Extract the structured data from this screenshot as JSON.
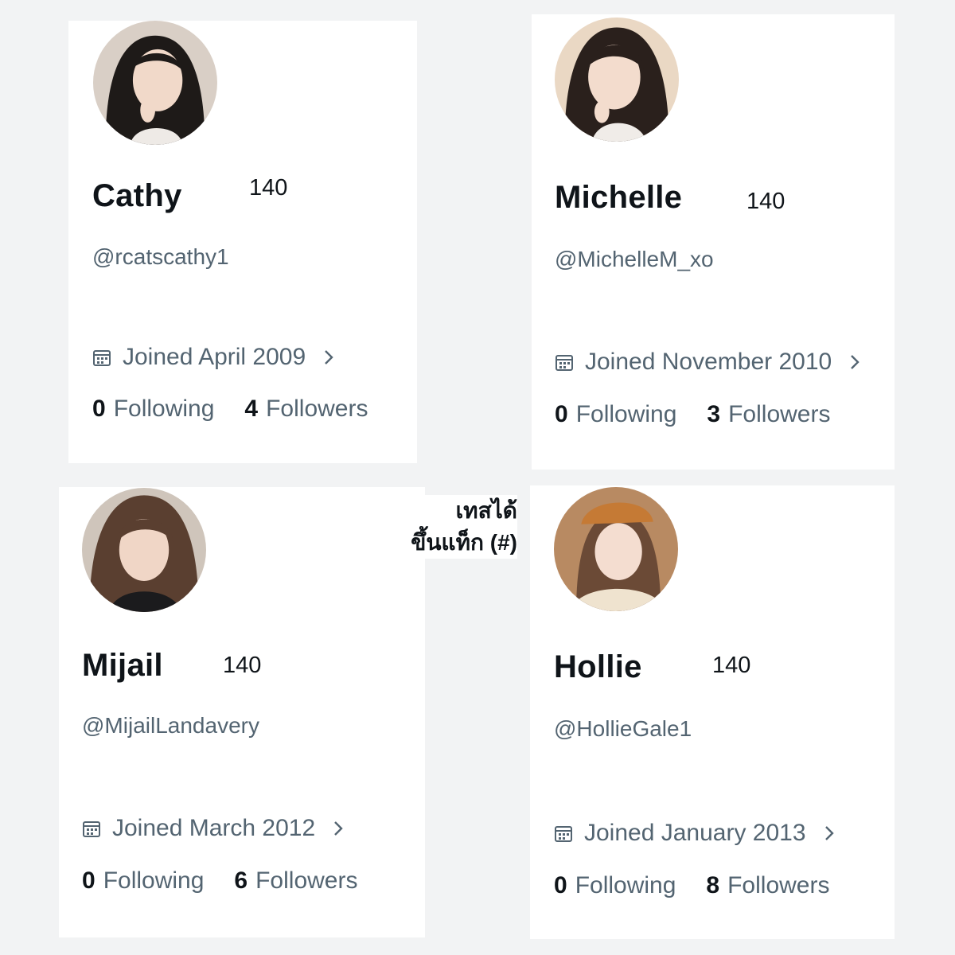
{
  "profiles": [
    {
      "name": "Cathy",
      "count": "140",
      "handle": "@rcatscathy1",
      "joined": "Joined April 2009",
      "following_count": "0",
      "following_label": "Following",
      "followers_count": "4",
      "followers_label": "Followers"
    },
    {
      "name": "Michelle",
      "count": "140",
      "handle": "@MichelleM_xo",
      "joined": "Joined November 2010",
      "following_count": "0",
      "following_label": "Following",
      "followers_count": "3",
      "followers_label": "Followers"
    },
    {
      "name": "Mijail",
      "count": "140",
      "handle": "@MijailLandavery",
      "joined": "Joined March 2012",
      "following_count": "0",
      "following_label": "Following",
      "followers_count": "6",
      "followers_label": "Followers"
    },
    {
      "name": "Hollie",
      "count": "140",
      "handle": "@HollieGale1",
      "joined": "Joined January 2013",
      "following_count": "0",
      "following_label": "Following",
      "followers_count": "8",
      "followers_label": "Followers"
    }
  ],
  "caption": {
    "line1": "เทสได้",
    "line2": "ขึ้นแท็ก (#)"
  },
  "icons": {
    "calendar": "calendar-icon",
    "chevron": "chevron-right-icon"
  },
  "colors": {
    "text_primary": "#0f1419",
    "text_secondary": "#536471",
    "card_bg": "#ffffff",
    "page_bg": "#f2f3f4"
  }
}
